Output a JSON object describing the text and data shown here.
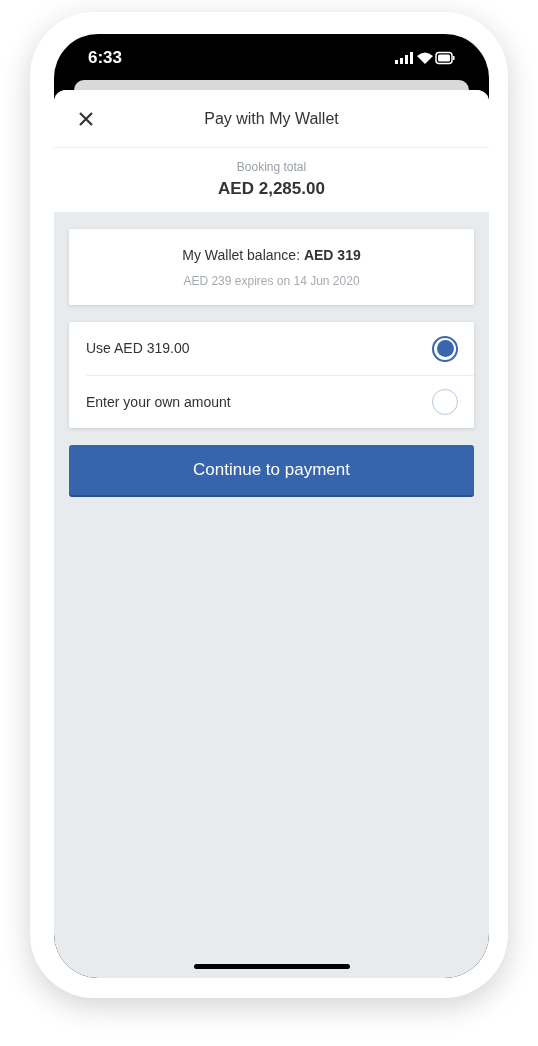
{
  "status_bar": {
    "time": "6:33"
  },
  "header": {
    "title": "Pay with My Wallet"
  },
  "summary": {
    "label": "Booking total",
    "amount": "AED 2,285.00"
  },
  "wallet": {
    "balance": "My Wallet balance: **AED 319**",
    "expiry": "AED 239 expires on 14 Jun 2020"
  },
  "options": [
    {
      "label": "Use AED 319.00",
      "selected": true
    },
    {
      "label": "Enter your own amount",
      "selected": false
    }
  ],
  "button": "Continue to payment"
}
